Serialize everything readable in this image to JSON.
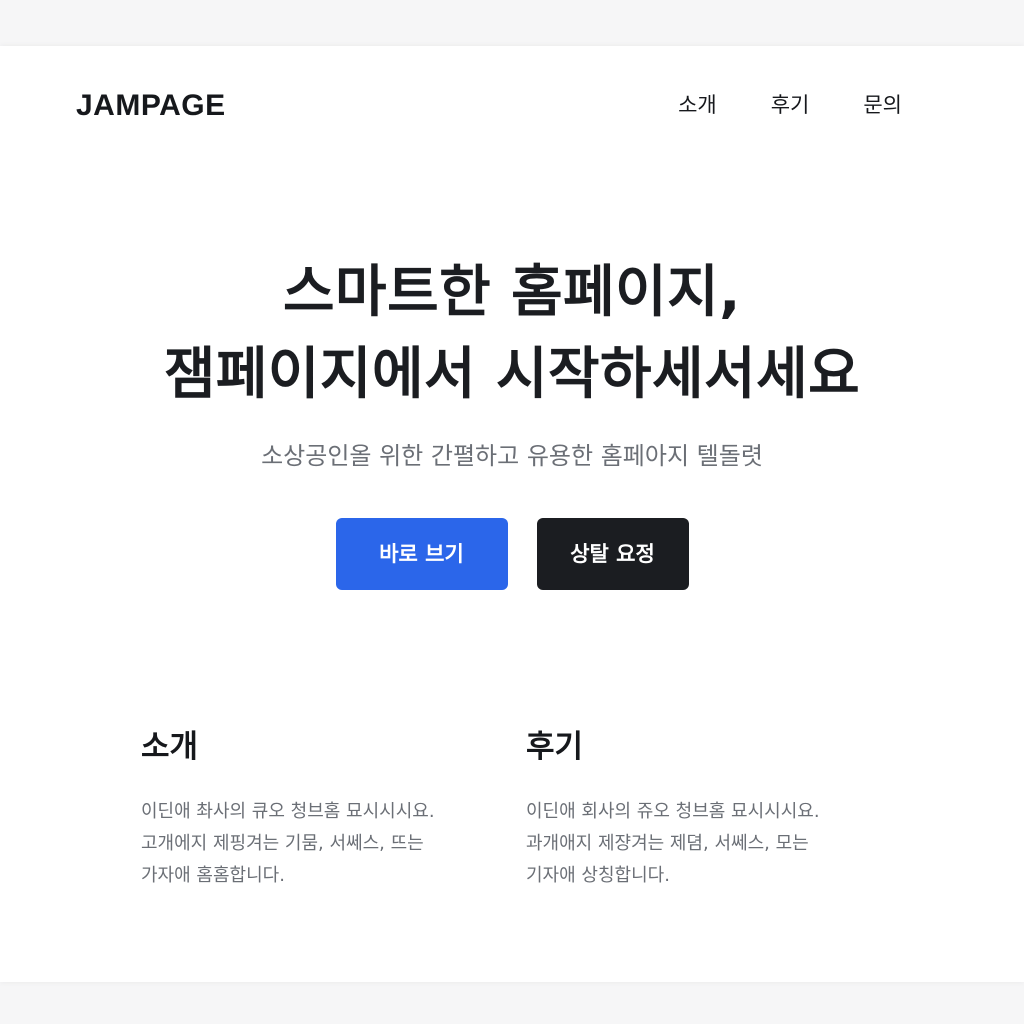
{
  "header": {
    "logo": "JAMPAGE",
    "nav": [
      "소개",
      "후기",
      "문의"
    ]
  },
  "hero": {
    "title_line1": "스마트한 홈페이지,",
    "title_line2": "잼페이지에서 시작하세서세요",
    "subtitle": "소상공인올 위한 간펼하고 유용한 홈페아지 텔돌렷"
  },
  "cta": {
    "primary_label": "바로 브기",
    "secondary_label": "상탈 요정"
  },
  "features": [
    {
      "title": "소개",
      "lines": [
        "이딘애 촤사의 큐오 청브홈 묘시시시요.",
        "고개에지 제핑겨는 기뭄, 서쎄스, 뜨는",
        "가자애 홈홈합니다."
      ]
    },
    {
      "title": "후기",
      "lines": [
        "이딘애 회사의 쥬오 청브홈 묘시시시요.",
        "과개애지 제쟝겨는 제뎜, 서쎄스, 모는",
        "기자애 상칭합니다."
      ]
    }
  ],
  "colors": {
    "primary": "#2b66ea",
    "dark": "#1b1d21",
    "muted_text": "#6b6f76",
    "page_bg": "#ffffff",
    "outer_bg": "#f6f6f7"
  }
}
